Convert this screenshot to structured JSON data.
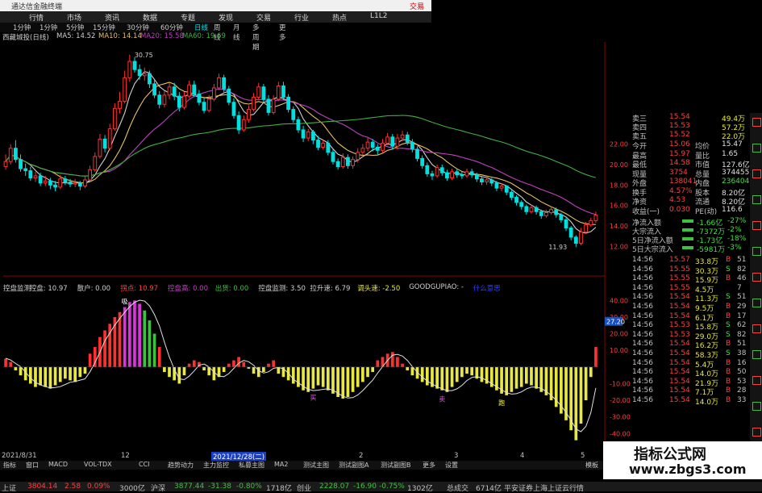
{
  "window": {
    "title": "通达信金融终端",
    "right_label": "交易"
  },
  "menu": [
    "行情",
    "市场",
    "资讯",
    "数据",
    "专题",
    "发现",
    "交易",
    "行业",
    "热点",
    "L1L2"
  ],
  "timeframes": [
    {
      "label": "1分钟",
      "active": false
    },
    {
      "label": "1分钟",
      "active": false
    },
    {
      "label": "5分钟",
      "active": false
    },
    {
      "label": "15分钟",
      "active": false
    },
    {
      "label": "30分钟",
      "active": false
    },
    {
      "label": "60分钟",
      "active": false
    },
    {
      "label": "日线",
      "active": true
    },
    {
      "label": "周线",
      "active": false
    },
    {
      "label": "月线",
      "active": false
    },
    {
      "label": "多周期",
      "active": false
    },
    {
      "label": "更多",
      "active": false
    }
  ],
  "stock_label": "西藏城投(日线)",
  "ma_legend": [
    {
      "text": "MA5: 14.52",
      "color": "#d0d0d0"
    },
    {
      "text": "MA10: 14.14",
      "color": "#e8c060"
    },
    {
      "text": "MA20: 15.58",
      "color": "#c040c0"
    },
    {
      "text": "MA60: 19.69",
      "color": "#40b040"
    }
  ],
  "indicator_legend": [
    {
      "text": "控盘监测",
      "color": "#d0d0d0"
    },
    {
      "text": "控盘: 10.97",
      "color": "#d0d0d0"
    },
    {
      "text": "散户: 0.00",
      "color": "#d0d0d0"
    },
    {
      "text": "拐点: 10.97",
      "color": "#ff4040"
    },
    {
      "text": "控盘高: 0.00",
      "color": "#c040c0"
    },
    {
      "text": "出货: 0.00",
      "color": "#40c040"
    },
    {
      "text": "控盘监测: 3.50",
      "color": "#d0d0d0"
    },
    {
      "text": "拉升速: 6.79",
      "color": "#d0d0d0"
    },
    {
      "text": "调头速: -2.50",
      "color": "#e8e840"
    },
    {
      "text": "GOODGUPIAO: -",
      "color": "#d0d0d0"
    },
    {
      "text": "什么意思",
      "color": "#3040ff"
    }
  ],
  "chart_data": {
    "type": "candlestick",
    "price_axis": {
      "ylim": [
        11,
        32
      ],
      "ticks": [
        12.0,
        14.0,
        16.0,
        18.0,
        20.0,
        22.0
      ]
    },
    "price_annotations": {
      "high": "30.75",
      "low": "11.93"
    },
    "candles": [
      [
        19.8,
        20.3,
        19.5,
        21.0
      ],
      [
        20.3,
        21.6,
        20.0,
        22.0
      ],
      [
        21.6,
        20.5,
        20.2,
        22.4
      ],
      [
        20.5,
        19.6,
        19.3,
        21.0
      ],
      [
        19.6,
        19.4,
        18.9,
        20.1
      ],
      [
        19.4,
        18.7,
        18.4,
        19.8
      ],
      [
        18.7,
        18.9,
        18.3,
        19.3
      ],
      [
        18.9,
        18.2,
        17.9,
        19.2
      ],
      [
        18.2,
        18.4,
        17.9,
        18.9
      ],
      [
        18.4,
        18.0,
        17.6,
        18.7
      ],
      [
        18.0,
        17.8,
        17.4,
        18.4
      ],
      [
        17.8,
        18.6,
        17.6,
        19.0
      ],
      [
        18.6,
        18.3,
        18.0,
        18.9
      ],
      [
        18.3,
        18.1,
        17.8,
        18.6
      ],
      [
        18.1,
        18.2,
        17.8,
        18.6
      ],
      [
        18.2,
        17.9,
        17.5,
        18.4
      ],
      [
        17.9,
        18.5,
        17.7,
        18.9
      ],
      [
        18.5,
        19.5,
        18.3,
        19.9
      ],
      [
        19.5,
        20.8,
        19.3,
        21.2
      ],
      [
        20.8,
        22.5,
        20.6,
        23.0
      ],
      [
        22.5,
        21.6,
        21.2,
        22.9
      ],
      [
        21.6,
        23.5,
        21.4,
        24.0
      ],
      [
        23.5,
        25.5,
        23.3,
        26.0
      ],
      [
        25.5,
        26.2,
        25.0,
        27.1
      ],
      [
        26.2,
        28.5,
        26.0,
        29.2
      ],
      [
        28.5,
        30.1,
        28.1,
        30.75
      ],
      [
        30.1,
        29.3,
        29.0,
        30.5
      ],
      [
        29.3,
        28.7,
        28.3,
        29.8
      ],
      [
        28.7,
        28.9,
        28.2,
        29.5
      ],
      [
        28.9,
        27.9,
        27.5,
        29.2
      ],
      [
        27.9,
        26.8,
        26.5,
        28.3
      ],
      [
        26.8,
        25.9,
        25.5,
        27.2
      ],
      [
        25.9,
        26.8,
        25.6,
        27.2
      ],
      [
        26.8,
        27.6,
        26.4,
        28.0
      ],
      [
        27.6,
        26.7,
        26.3,
        28.0
      ],
      [
        26.7,
        25.6,
        25.2,
        27.1
      ],
      [
        25.6,
        26.7,
        25.4,
        27.1
      ],
      [
        26.7,
        27.8,
        26.5,
        28.2
      ],
      [
        27.8,
        26.9,
        26.6,
        28.2
      ],
      [
        26.9,
        26.1,
        25.8,
        27.3
      ],
      [
        26.1,
        25.3,
        25.0,
        26.5
      ],
      [
        25.3,
        26.4,
        25.1,
        26.8
      ],
      [
        26.4,
        27.5,
        26.2,
        27.9
      ],
      [
        27.5,
        28.5,
        27.3,
        28.9
      ],
      [
        28.5,
        27.4,
        27.1,
        28.8
      ],
      [
        27.4,
        26.1,
        25.8,
        27.7
      ],
      [
        26.1,
        24.8,
        24.5,
        26.5
      ],
      [
        24.8,
        23.4,
        23.0,
        25.2
      ],
      [
        23.4,
        24.4,
        23.2,
        24.8
      ],
      [
        24.4,
        25.4,
        24.1,
        25.8
      ],
      [
        25.4,
        26.6,
        25.2,
        27.0
      ],
      [
        26.6,
        27.6,
        26.3,
        28.0
      ],
      [
        27.6,
        26.4,
        26.1,
        27.9
      ],
      [
        26.4,
        25.1,
        24.8,
        26.8
      ],
      [
        25.1,
        26.4,
        24.9,
        26.8
      ],
      [
        26.4,
        27.7,
        26.2,
        28.1
      ],
      [
        27.7,
        26.6,
        26.3,
        28.1
      ],
      [
        26.6,
        25.4,
        25.1,
        26.9
      ],
      [
        25.4,
        24.4,
        24.1,
        25.7
      ],
      [
        24.4,
        23.4,
        23.1,
        24.7
      ],
      [
        23.4,
        22.6,
        22.2,
        23.8
      ],
      [
        22.6,
        23.2,
        22.3,
        23.5
      ],
      [
        23.2,
        22.4,
        22.0,
        23.4
      ],
      [
        22.4,
        21.7,
        21.4,
        22.8
      ],
      [
        21.7,
        22.1,
        21.5,
        22.4
      ],
      [
        22.1,
        21.2,
        20.9,
        22.4
      ],
      [
        21.2,
        20.3,
        20.0,
        21.5
      ],
      [
        20.3,
        19.8,
        19.5,
        20.6
      ],
      [
        19.8,
        20.7,
        19.6,
        21.1
      ],
      [
        20.7,
        19.9,
        19.6,
        21.0
      ],
      [
        19.9,
        20.5,
        19.6,
        20.8
      ],
      [
        20.5,
        21.2,
        20.2,
        21.6
      ],
      [
        21.2,
        21.6,
        20.9,
        22.0
      ],
      [
        21.6,
        22.2,
        21.3,
        22.6
      ],
      [
        22.2,
        21.7,
        21.3,
        22.5
      ],
      [
        21.7,
        21.4,
        21.0,
        22.0
      ],
      [
        21.4,
        22.1,
        21.2,
        22.5
      ],
      [
        22.1,
        22.7,
        21.9,
        23.1
      ],
      [
        22.7,
        21.8,
        21.5,
        23.0
      ],
      [
        21.8,
        22.6,
        21.5,
        23.0
      ],
      [
        22.6,
        22.9,
        22.3,
        23.3
      ],
      [
        22.9,
        22.2,
        21.9,
        23.2
      ],
      [
        22.2,
        21.5,
        21.2,
        22.5
      ],
      [
        21.5,
        20.6,
        20.3,
        21.8
      ],
      [
        20.6,
        19.9,
        19.6,
        20.9
      ],
      [
        19.9,
        19.1,
        18.8,
        20.2
      ],
      [
        19.1,
        18.9,
        18.5,
        19.4
      ],
      [
        18.9,
        19.7,
        18.7,
        20.0
      ],
      [
        19.7,
        19.2,
        18.9,
        20.0
      ],
      [
        19.2,
        18.7,
        18.4,
        19.5
      ],
      [
        18.7,
        19.3,
        18.5,
        19.6
      ],
      [
        19.3,
        19.0,
        18.7,
        19.6
      ],
      [
        19.0,
        18.9,
        18.6,
        19.3
      ],
      [
        18.9,
        19.3,
        18.7,
        19.6
      ],
      [
        19.3,
        19.0,
        18.7,
        19.6
      ],
      [
        19.0,
        18.6,
        18.3,
        19.2
      ],
      [
        18.6,
        18.3,
        18.0,
        18.9
      ],
      [
        18.3,
        18.5,
        18.0,
        18.8
      ],
      [
        18.5,
        18.2,
        17.9,
        18.7
      ],
      [
        18.2,
        17.7,
        17.4,
        18.4
      ],
      [
        17.7,
        17.9,
        17.4,
        18.2
      ],
      [
        17.9,
        17.3,
        17.0,
        18.0
      ],
      [
        17.3,
        16.8,
        16.5,
        17.5
      ],
      [
        16.8,
        16.3,
        16.0,
        17.0
      ],
      [
        16.3,
        15.9,
        15.6,
        16.5
      ],
      [
        15.9,
        15.4,
        15.1,
        16.1
      ],
      [
        15.4,
        15.8,
        15.2,
        16.1
      ],
      [
        15.8,
        15.4,
        15.1,
        16.0
      ],
      [
        15.4,
        15.0,
        14.7,
        15.6
      ],
      [
        15.0,
        15.3,
        14.8,
        15.6
      ],
      [
        15.3,
        15.6,
        15.1,
        15.9
      ],
      [
        15.6,
        15.1,
        14.8,
        15.8
      ],
      [
        15.1,
        14.6,
        14.3,
        15.3
      ],
      [
        14.6,
        13.8,
        13.5,
        14.8
      ],
      [
        13.8,
        12.9,
        12.6,
        14.0
      ],
      [
        12.9,
        12.3,
        11.93,
        13.1
      ],
      [
        12.3,
        13.4,
        12.1,
        13.8
      ],
      [
        13.4,
        14.1,
        13.2,
        14.4
      ],
      [
        14.1,
        14.52,
        13.9,
        14.8
      ],
      [
        14.52,
        15.06,
        14.3,
        15.4
      ]
    ],
    "indicator_axis": {
      "ylim": [
        -50,
        45
      ],
      "ticks": [
        40.0,
        30.0,
        20.0,
        10.0,
        -10.0,
        -20.0,
        -30.0,
        -40.0
      ],
      "highlight": "27.20"
    },
    "indicator_bars": [
      5,
      3,
      -2,
      -5,
      -8,
      -10,
      -12,
      -11,
      -12,
      -13,
      -11,
      -9,
      -7,
      -8,
      -9,
      -6,
      -4,
      8,
      12,
      18,
      22,
      26,
      30,
      33,
      36,
      39,
      40,
      38,
      34,
      28,
      20,
      12,
      -3,
      -6,
      -8,
      -10,
      -5,
      2,
      4,
      3,
      -2,
      -5,
      -8,
      -6,
      -3,
      2,
      4,
      6,
      3,
      -1,
      -4,
      -6,
      -3,
      2,
      4,
      -4,
      -6,
      -8,
      -10,
      -12,
      -14,
      -15,
      -13,
      -11,
      -12,
      -14,
      -16,
      -18,
      -19,
      -18,
      -15,
      -12,
      -9,
      -6,
      -3,
      4,
      6,
      8,
      9,
      6,
      2,
      -2,
      -5,
      -7,
      -9,
      -11,
      -12,
      -13,
      -14,
      -15,
      -12,
      -9,
      -6,
      -4,
      -5,
      -7,
      -9,
      -10,
      -12,
      -14,
      -16,
      -17,
      -15,
      -13,
      -12,
      -10,
      -11,
      -13,
      -15,
      -17,
      -20,
      -24,
      -28,
      -32,
      -38,
      -44,
      -34,
      -20,
      -6,
      12
    ],
    "markers": [
      "吸",
      "买",
      "卖",
      "跑"
    ]
  },
  "quote_panel": {
    "asks": [
      {
        "label": "卖三",
        "price": "15.54",
        "vol": "49.4万"
      },
      {
        "label": "卖四",
        "price": "15.53",
        "vol": "57.2万"
      },
      {
        "label": "卖五",
        "price": "15.52",
        "vol": "22.0万"
      }
    ],
    "stats": [
      {
        "k": "今开",
        "v": "15.06",
        "k2": "均价",
        "v2": "15.47"
      },
      {
        "k": "最高",
        "v": "15.97",
        "k2": "量比",
        "v2": "1.65"
      },
      {
        "k": "最低",
        "v": "14.58",
        "k2": "市值",
        "v2": "127.6亿"
      },
      {
        "k": "现量",
        "v": "3754",
        "k2": "总量",
        "v2": "374455"
      },
      {
        "k": "外盘",
        "v": "138041",
        "k2": "内盘",
        "v2": "236404"
      },
      {
        "k": "换手",
        "v": "4.57%",
        "k2": "股本",
        "v2": "8.20亿"
      },
      {
        "k": "净资",
        "v": "4.53",
        "k2": "流通",
        "v2": "8.20亿"
      },
      {
        "k": "收益(一)",
        "v": "0.030",
        "k2": "PE(动)",
        "v2": "116.6"
      }
    ],
    "flows": [
      {
        "k": "净流入额",
        "v": "-1.66亿",
        "p": "-27%"
      },
      {
        "k": "大宗流入",
        "v": "-7372万",
        "p": "-2%"
      },
      {
        "k": "5日净流入额",
        "v": "-1.73亿",
        "p": "-18%"
      },
      {
        "k": "5日大宗流入",
        "v": "-5981万",
        "p": "-3%"
      }
    ],
    "ticks": [
      {
        "t": "14:56",
        "p": "15.57",
        "v": "33.8万",
        "s": "B",
        "n": "51"
      },
      {
        "t": "14:56",
        "p": "15.55",
        "v": "30.3万",
        "s": "S",
        "n": "82"
      },
      {
        "t": "14:56",
        "p": "15.55",
        "v": "15.9万",
        "s": "B",
        "n": "46"
      },
      {
        "t": "14:56",
        "p": "15.55",
        "v": "4.5万",
        "s": "",
        "n": "7"
      },
      {
        "t": "14:56",
        "p": "15.54",
        "v": "11.3万",
        "s": "S",
        "n": "51"
      },
      {
        "t": "14:56",
        "p": "15.54",
        "v": "9.5万",
        "s": "B",
        "n": "29"
      },
      {
        "t": "14:56",
        "p": "15.54",
        "v": "6.1万",
        "s": "B",
        "n": "17"
      },
      {
        "t": "14:56",
        "p": "15.53",
        "v": "15.8万",
        "s": "S",
        "n": "62"
      },
      {
        "t": "14:56",
        "p": "15.53",
        "v": "29.0万",
        "s": "S",
        "n": "82"
      },
      {
        "t": "14:56",
        "p": "15.54",
        "v": "16.2万",
        "s": "B",
        "n": "51"
      },
      {
        "t": "14:56",
        "p": "15.54",
        "v": "58.3万",
        "s": "S",
        "n": "38"
      },
      {
        "t": "14:56",
        "p": "15.54",
        "v": "5.4万",
        "s": "B",
        "n": "16"
      },
      {
        "t": "14:56",
        "p": "15.54",
        "v": "14.0万",
        "s": "B",
        "n": "50"
      },
      {
        "t": "14:56",
        "p": "15.54",
        "v": "21.9万",
        "s": "B",
        "n": "53"
      },
      {
        "t": "14:56",
        "p": "15.54",
        "v": "7.1万",
        "s": "B",
        "n": "28"
      },
      {
        "t": "14:56",
        "p": "15.54",
        "v": "14.0万",
        "s": "B",
        "n": "33"
      }
    ]
  },
  "date_axis": {
    "left": "2021/8/31",
    "highlight": "2021/12/28(二)",
    "marks": [
      "12",
      "2",
      "3",
      "4",
      "5"
    ]
  },
  "bottom_tabs": [
    "指标",
    "窗口",
    "MACD",
    "VOL-TDX",
    "CCI",
    "趋势动力",
    "主力监控",
    "私募主图",
    "MA2",
    "测试主图",
    "测试副图A",
    "测试副图B",
    "更多",
    "设置"
  ],
  "bottom_right": "模板",
  "status_bar": [
    {
      "text": "上证",
      "color": "#c0c0c0"
    },
    {
      "text": "3804.14",
      "color": "#ff4040"
    },
    {
      "text": "2.58",
      "color": "#ff4040"
    },
    {
      "text": "0.09%",
      "color": "#ff4040"
    },
    {
      "text": "3000亿",
      "color": "#c0c0c0"
    },
    {
      "text": "沪深",
      "color": "#c0c0c0"
    },
    {
      "text": "3877.44",
      "color": "#40c040"
    },
    {
      "text": "-31.38",
      "color": "#40c040"
    },
    {
      "text": "-0.80%",
      "color": "#40c040"
    },
    {
      "text": "1718亿",
      "color": "#c0c0c0"
    },
    {
      "text": "创业",
      "color": "#c0c0c0"
    },
    {
      "text": "2228.07",
      "color": "#40c040"
    },
    {
      "text": "-16.90",
      "color": "#40c040"
    },
    {
      "text": "-0.75%",
      "color": "#40c040"
    },
    {
      "text": "1302亿",
      "color": "#c0c0c0"
    },
    {
      "text": "总成交",
      "color": "#c0c0c0"
    },
    {
      "text": "6714亿",
      "color": "#c0c0c0"
    },
    {
      "text": "平安证券上海上证云行情",
      "color": "#c0c0c0"
    }
  ],
  "watermark": {
    "line1": "指标公式网",
    "line2": "www.zbgs3.com"
  },
  "colors": {
    "up": "#ff3030",
    "down": "#00e0e0",
    "ma5": "#d0d0d0",
    "ma10": "#e8c060",
    "ma20": "#c040c0",
    "ma60": "#40b040",
    "ind_neg": "#e8e840",
    "ind_pos": "#ff3030",
    "ind_peak": "#e030e0",
    "ind_mid": "#40c040"
  }
}
